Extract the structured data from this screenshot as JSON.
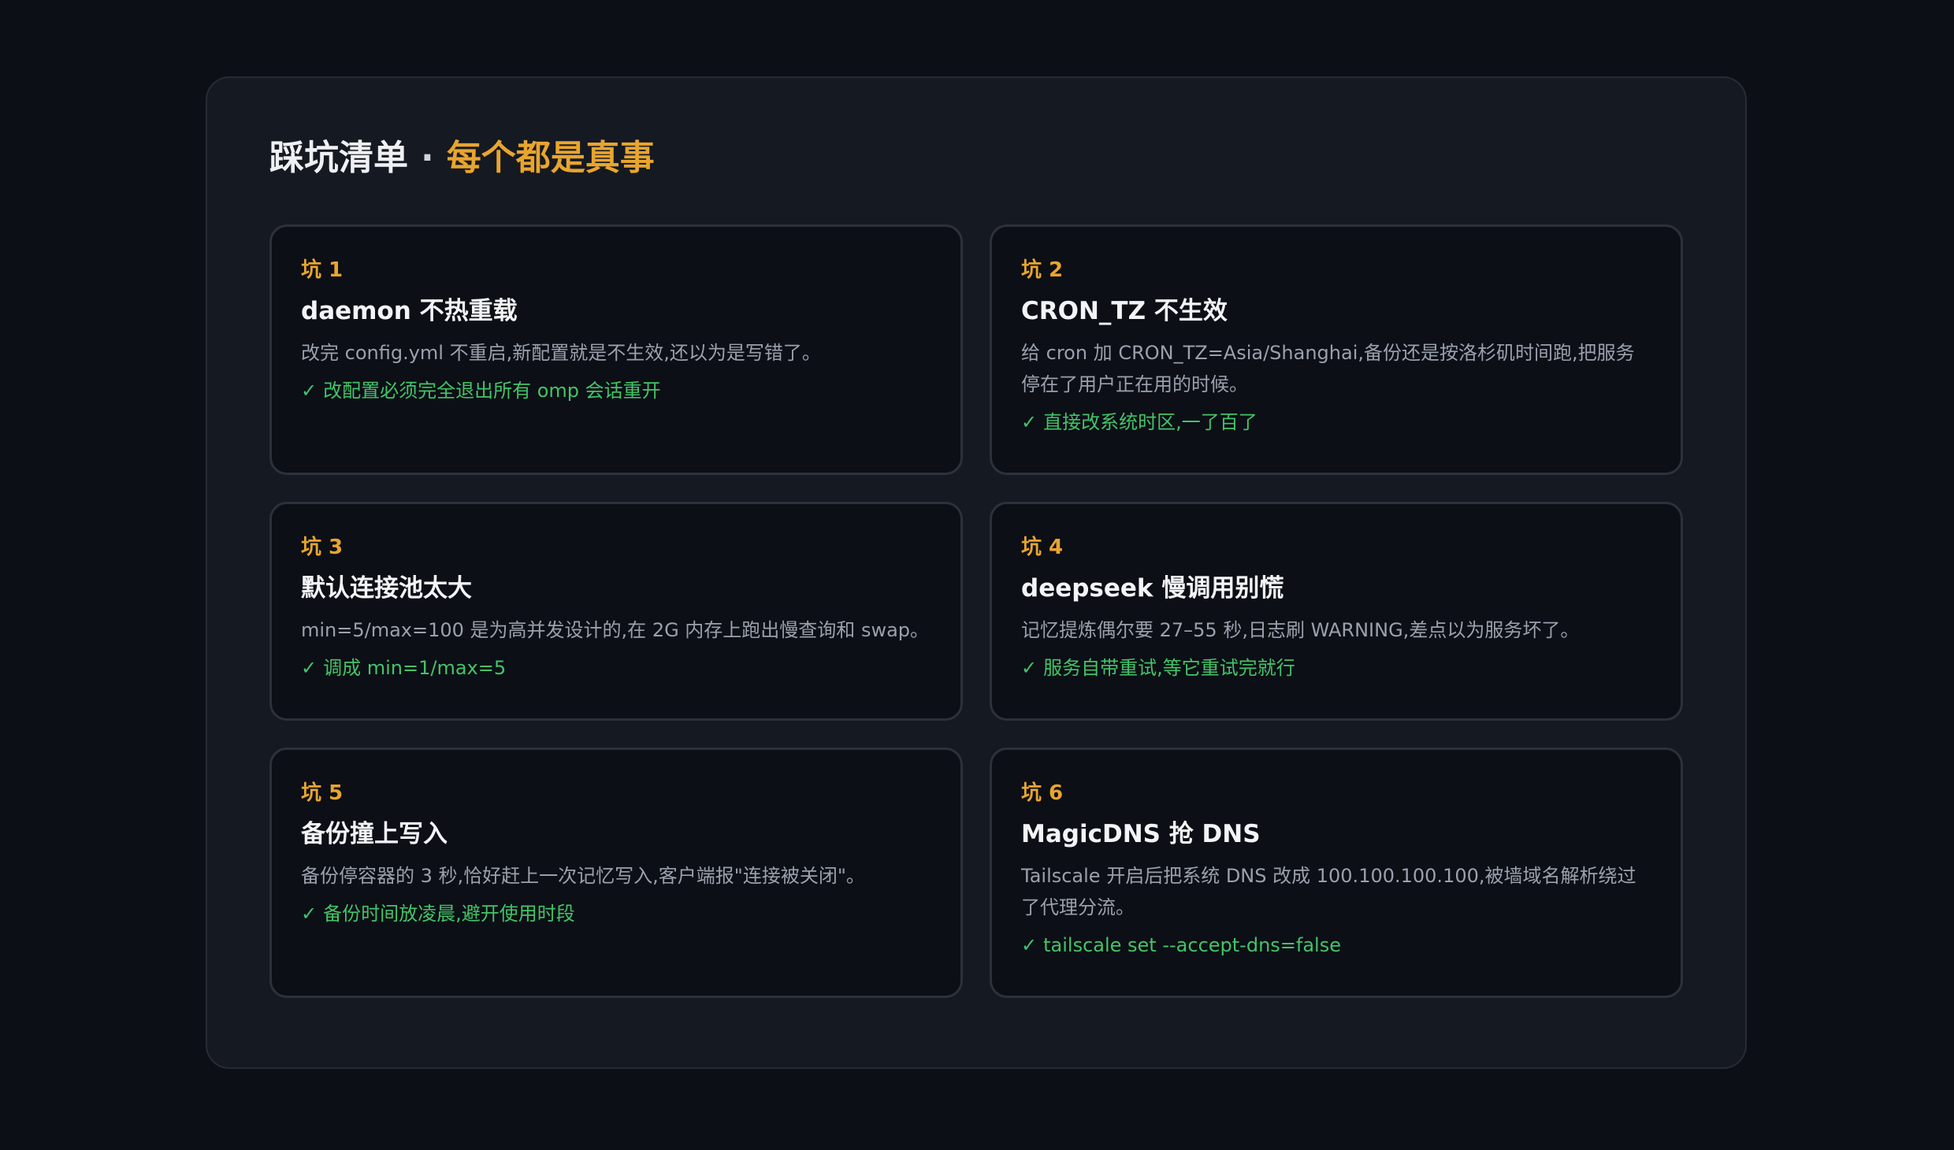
{
  "header": {
    "title_main": "踩坑清单",
    "title_separator": "·",
    "title_accent": "每个都是真事"
  },
  "colors": {
    "background": "#0c0f16",
    "panel": "#151921",
    "accent": "#e8a52e",
    "success": "#43c467",
    "text_muted": "#9aa1ac"
  },
  "icons": {
    "fix": "check-mark-icon"
  },
  "check_glyph": "✓",
  "cards": [
    {
      "tag": "坑 1",
      "title": "daemon 不热重载",
      "description": "改完 config.yml 不重启,新配置就是不生效,还以为是写错了。",
      "fix": "改配置必须完全退出所有 omp 会话重开"
    },
    {
      "tag": "坑 2",
      "title": "CRON_TZ 不生效",
      "description": "给 cron 加 CRON_TZ=Asia/Shanghai,备份还是按洛杉矶时间跑,把服务停在了用户正在用的时候。",
      "fix": "直接改系统时区,一了百了"
    },
    {
      "tag": "坑 3",
      "title": "默认连接池太大",
      "description": "min=5/max=100 是为高并发设计的,在 2G 内存上跑出慢查询和 swap。",
      "fix": "调成 min=1/max=5"
    },
    {
      "tag": "坑 4",
      "title": "deepseek 慢调用别慌",
      "description": "记忆提炼偶尔要 27–55 秒,日志刷 WARNING,差点以为服务坏了。",
      "fix": "服务自带重试,等它重试完就行"
    },
    {
      "tag": "坑 5",
      "title": "备份撞上写入",
      "description": "备份停容器的 3 秒,恰好赶上一次记忆写入,客户端报\"连接被关闭\"。",
      "fix": "备份时间放凌晨,避开使用时段"
    },
    {
      "tag": "坑 6",
      "title": "MagicDNS 抢 DNS",
      "description": "Tailscale 开启后把系统 DNS 改成 100.100.100.100,被墙域名解析绕过了代理分流。",
      "fix": "tailscale set --accept-dns=false"
    }
  ]
}
